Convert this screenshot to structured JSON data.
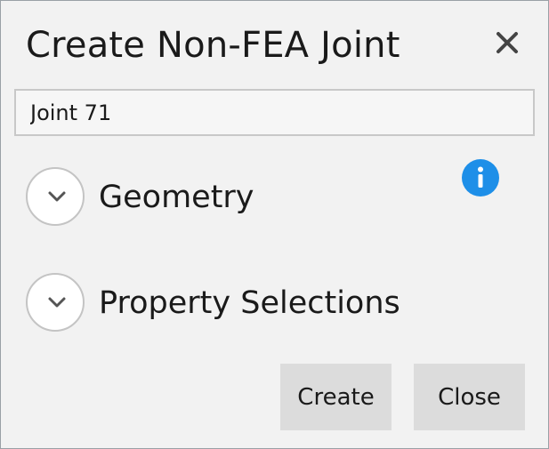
{
  "dialog": {
    "title": "Create Non-FEA Joint",
    "close_icon": "close-icon"
  },
  "name_field": {
    "value": "Joint 71"
  },
  "sections": [
    {
      "label": "Geometry",
      "icon": "chevron-down-icon",
      "expanded": false
    },
    {
      "label": "Property Selections",
      "icon": "chevron-down-icon",
      "expanded": false
    }
  ],
  "info": {
    "icon": "info-icon",
    "color": "#1e8fe8"
  },
  "buttons": {
    "create_label": "Create",
    "close_label": "Close"
  }
}
